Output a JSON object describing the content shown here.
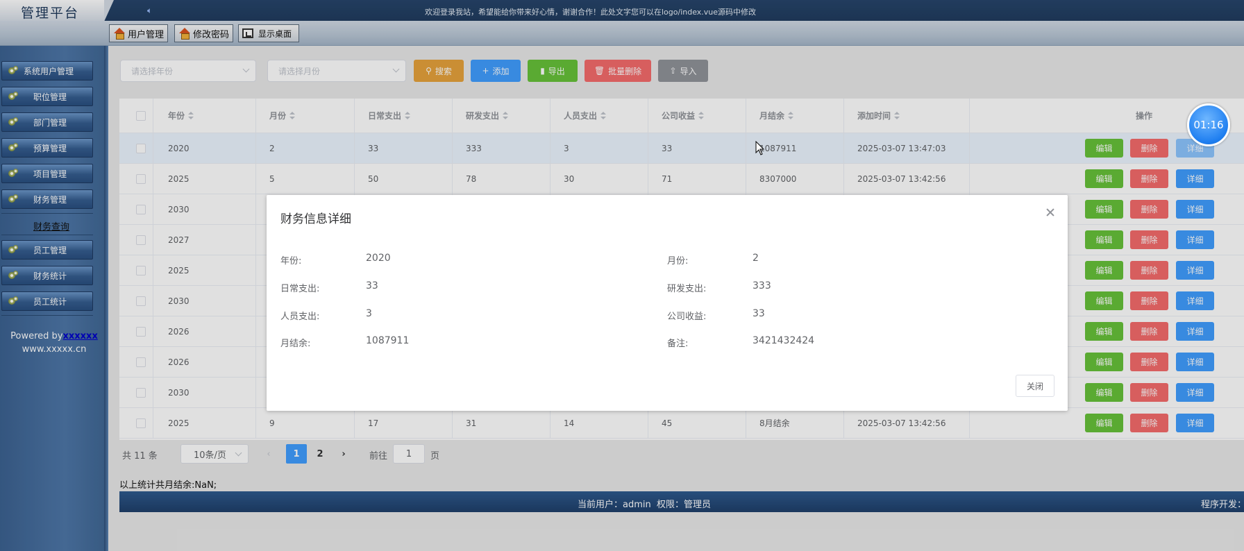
{
  "header": {
    "logo": "管理平台",
    "marquee": "欢迎登录我站，希望能给你带来好心情，谢谢合作！此处文字您可以在logo/index.vue源码中修改"
  },
  "toolbar": {
    "user_mgmt": "用户管理",
    "change_pwd": "修改密码",
    "show_desktop": "显示桌面"
  },
  "sidebar": {
    "items": [
      "系统用户管理",
      "职位管理",
      "部门管理",
      "预算管理",
      "项目管理",
      "财务管理",
      "员工管理",
      "财务统计",
      "员工统计"
    ],
    "sub_item": "财务查询",
    "powered_prefix": "Powered by",
    "powered_link": "xxxxxx",
    "site": "www.xxxxx.cn"
  },
  "filters": {
    "year_placeholder": "请选择年份",
    "month_placeholder": "请选择月份"
  },
  "actions": {
    "search": "搜索",
    "add": "添加",
    "export": "导出",
    "batch_delete": "批量删除",
    "import": "导入"
  },
  "colors": {
    "search": "#e6a23c",
    "add": "#409eff",
    "export": "#67c23a",
    "batch_delete": "#f56c6c",
    "import": "#909399"
  },
  "table": {
    "headers": [
      "年份",
      "月份",
      "日常支出",
      "研发支出",
      "人员支出",
      "公司收益",
      "月结余",
      "添加时间",
      "操作"
    ],
    "op_labels": {
      "edit": "编辑",
      "delete": "删除",
      "detail": "详细"
    },
    "rows": [
      [
        "2020",
        "2",
        "33",
        "333",
        "3",
        "33",
        "1087911",
        "2025-03-07 13:47:03"
      ],
      [
        "2025",
        "5",
        "50",
        "78",
        "30",
        "71",
        "8307000",
        "2025-03-07 13:42:56"
      ],
      [
        "2030",
        "",
        "",
        "",
        "",
        "",
        "",
        ""
      ],
      [
        "2027",
        "",
        "",
        "",
        "",
        "",
        "",
        ""
      ],
      [
        "2025",
        "",
        "",
        "",
        "",
        "",
        "",
        ""
      ],
      [
        "2030",
        "",
        "",
        "",
        "",
        "",
        "",
        ""
      ],
      [
        "2026",
        "",
        "",
        "",
        "",
        "",
        "",
        ""
      ],
      [
        "2026",
        "",
        "",
        "",
        "",
        "",
        "",
        ""
      ],
      [
        "2030",
        "",
        "",
        "",
        "",
        "",
        "",
        ""
      ],
      [
        "2025",
        "9",
        "17",
        "31",
        "14",
        "45",
        "8月结余",
        "2025-03-07 13:42:56"
      ]
    ]
  },
  "pagination": {
    "total": "共 11 条",
    "page_size": "10条/页",
    "pages": [
      "1",
      "2"
    ],
    "goto_label": "前往",
    "goto_value": "1",
    "page_unit": "页"
  },
  "summary": "以上统计共月结余:NaN;",
  "footer": {
    "current_user": "当前用户：admin  权限：管理员",
    "developer": "程序开发：xx"
  },
  "dialog": {
    "title": "财务信息详细",
    "fields": [
      {
        "label": "年份:",
        "value": "2020"
      },
      {
        "label": "月份:",
        "value": "2"
      },
      {
        "label": "日常支出:",
        "value": "33"
      },
      {
        "label": "研发支出:",
        "value": "333"
      },
      {
        "label": "人员支出:",
        "value": "3"
      },
      {
        "label": "公司收益:",
        "value": "33"
      },
      {
        "label": "月结余:",
        "value": "1087911"
      },
      {
        "label": "备注:",
        "value": "3421432424"
      }
    ],
    "close_button": "关闭"
  },
  "timer": "01:16"
}
